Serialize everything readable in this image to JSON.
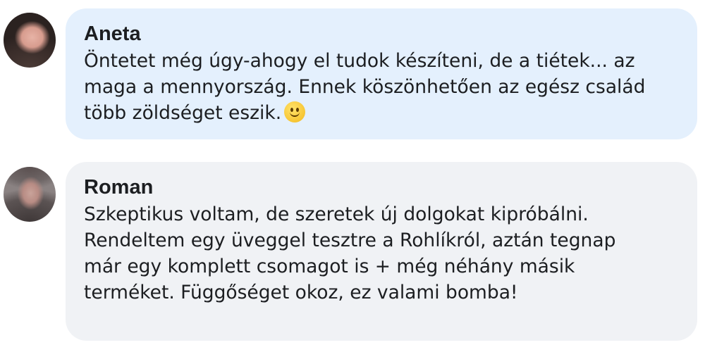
{
  "comments": [
    {
      "author": "Aneta",
      "lines": [
        "Öntetet még úgy-ahogy el tudok készíteni, de a tiétek... az",
        "maga a mennyország. Ennek köszönhetően az egész család",
        "több zöldséget eszik."
      ],
      "emoji": "slightly-smiling-face-icon",
      "bubble_color": "#e4f0fd"
    },
    {
      "author": "Roman",
      "lines": [
        "Szkeptikus voltam, de szeretek új dolgokat kipróbálni.",
        "Rendeltem egy üveggel tesztre a Rohlíkról, aztán tegnap",
        "már egy komplett csomagot is + még néhány másik",
        "terméket. Függőséget okoz, ez valami bomba!"
      ],
      "bubble_color": "#f0f2f5"
    }
  ]
}
